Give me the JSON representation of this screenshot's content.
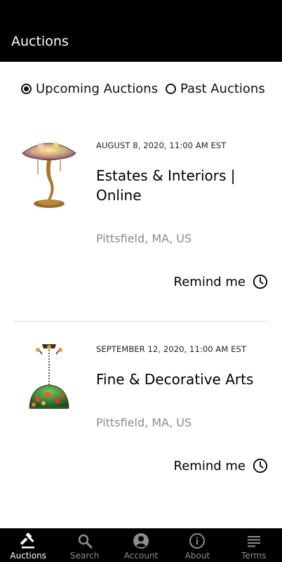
{
  "header": {
    "title": "Auctions"
  },
  "filters": [
    {
      "label": "Upcoming Auctions",
      "selected": true
    },
    {
      "label": "Past Auctions",
      "selected": false
    }
  ],
  "auctions": [
    {
      "date": "AUGUST 8, 2020, 11:00 AM EST",
      "title": "Estates & Interiors | Online",
      "location": "Pittsfield, MA, US",
      "remind_label": "Remind me",
      "image": "table-lamp-thumbnail"
    },
    {
      "date": "SEPTEMBER 12, 2020, 11:00 AM EST",
      "title": "Fine & Decorative Arts",
      "location": "Pittsfield, MA, US",
      "remind_label": "Remind me",
      "image": "hanging-lamp-thumbnail"
    }
  ],
  "bottom_nav": [
    {
      "label": "Auctions",
      "icon": "gavel-icon",
      "active": true
    },
    {
      "label": "Search",
      "icon": "search-icon",
      "active": false
    },
    {
      "label": "Account",
      "icon": "account-icon",
      "active": false
    },
    {
      "label": "About",
      "icon": "info-icon",
      "active": false
    },
    {
      "label": "Terms",
      "icon": "terms-icon",
      "active": false
    }
  ],
  "colors": {
    "bar_background": "#000000",
    "location_text": "#8a8a8a",
    "inactive_nav": "#8c8c8c"
  }
}
